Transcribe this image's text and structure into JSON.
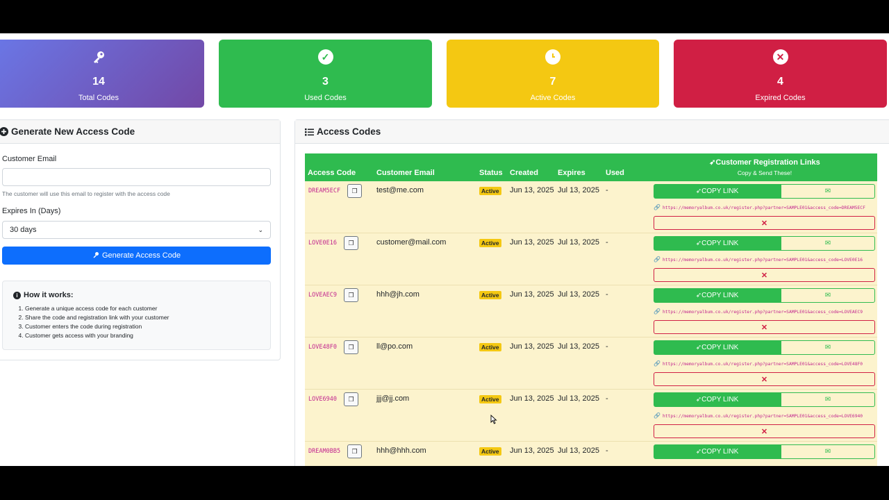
{
  "stats": [
    {
      "icon": "key-icon",
      "value": "14",
      "label": "Total Codes"
    },
    {
      "icon": "check-circle-icon",
      "value": "3",
      "label": "Used Codes"
    },
    {
      "icon": "clock-icon",
      "value": "7",
      "label": "Active Codes"
    },
    {
      "icon": "x-circle-icon",
      "value": "4",
      "label": "Expired Codes"
    }
  ],
  "generate": {
    "title": "Generate New Access Code",
    "email_label": "Customer Email",
    "email_value": "",
    "email_help": "The customer will use this email to register with the access code",
    "expires_label": "Expires In (Days)",
    "expires_selected": "30 days",
    "button_label": "Generate Access Code",
    "how_title": "How it works:",
    "how_steps": [
      "Generate a unique access code for each customer",
      "Share the code and registration link with your customer",
      "Customer enters the code during registration",
      "Customer gets access with your branding"
    ]
  },
  "codes": {
    "title": "Access Codes",
    "headers": {
      "code": "Access Code",
      "email": "Customer Email",
      "status": "Status",
      "created": "Created",
      "expires": "Expires",
      "used": "Used",
      "links": "Customer Registration Links",
      "links_sub": "Copy & Send These!"
    },
    "copy_link_label": "COPY LINK",
    "rows": [
      {
        "code": "DREAM5ECF",
        "email": "test@me.com",
        "status": "Active",
        "created": "Jun 13, 2025",
        "expires": "Jul 13, 2025",
        "used": "-",
        "url": "https://memoryalbum.co.uk/register.php?partner=SAMPLE01&access_code=DREAM5ECF"
      },
      {
        "code": "LOVE0E16",
        "email": "customer@mail.com",
        "status": "Active",
        "created": "Jun 13, 2025",
        "expires": "Jul 13, 2025",
        "used": "-",
        "url": "https://memoryalbum.co.uk/register.php?partner=SAMPLE01&access_code=LOVE0E16"
      },
      {
        "code": "LOVEAEC9",
        "email": "hhh@jh.com",
        "status": "Active",
        "created": "Jun 13, 2025",
        "expires": "Jul 13, 2025",
        "used": "-",
        "url": "https://memoryalbum.co.uk/register.php?partner=SAMPLE01&access_code=LOVEAEC9"
      },
      {
        "code": "LOVE48F0",
        "email": "ll@po.com",
        "status": "Active",
        "created": "Jun 13, 2025",
        "expires": "Jul 13, 2025",
        "used": "-",
        "url": "https://memoryalbum.co.uk/register.php?partner=SAMPLE01&access_code=LOVE48F0"
      },
      {
        "code": "LOVE6940",
        "email": "jjj@jj.com",
        "status": "Active",
        "created": "Jun 13, 2025",
        "expires": "Jul 13, 2025",
        "used": "-",
        "url": "https://memoryalbum.co.uk/register.php?partner=SAMPLE01&access_code=LOVE6940"
      },
      {
        "code": "DREAM0BB5",
        "email": "hhh@hhh.com",
        "status": "Active",
        "created": "Jun 13, 2025",
        "expires": "Jul 13, 2025",
        "used": "-",
        "url": ""
      }
    ]
  }
}
